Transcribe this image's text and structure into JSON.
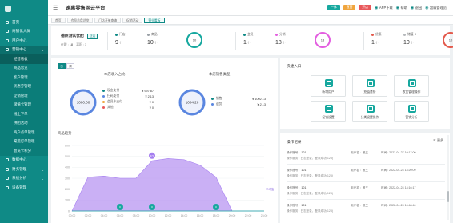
{
  "app_title": "速惠零售网云平台",
  "topbar": {
    "badges": [
      {
        "label": "一体",
        "color": "#17a89f"
      },
      {
        "label": "直营",
        "color": "#f0a53d"
      },
      {
        "label": "开店",
        "color": "#e8585a"
      }
    ],
    "links": [
      "APP下载",
      "帮助",
      "退出",
      "超级管理员"
    ]
  },
  "sidebar": {
    "items": [
      {
        "label": "首页",
        "expandable": false
      },
      {
        "label": "商铺化大屏",
        "expandable": false
      },
      {
        "label": "用户中心",
        "expandable": true
      },
      {
        "label": "营销中心",
        "expandable": true
      }
    ],
    "subitems": [
      "经营看板",
      "商品总览",
      "客户管理",
      "优惠券管理",
      "促销管理",
      "储值卡管理",
      "线上下单",
      "拼团活动",
      "商户点单管理",
      "渠道订单管理",
      "会员卡积分"
    ],
    "bottom": [
      {
        "label": "数据中心",
        "expandable": true
      },
      {
        "label": "财务管理",
        "expandable": true
      },
      {
        "label": "系统分析",
        "expandable": true
      },
      {
        "label": "设备管理",
        "expandable": true
      }
    ]
  },
  "tabs": [
    "首页",
    "会员总盘总览",
    "门店开单查询",
    "促销活动",
    "营业看板"
  ],
  "shop": {
    "name": "德州测试优配",
    "tag": "正店",
    "meta_label_1": "在职 :",
    "meta_value_1": "18",
    "meta_label_2": "离职 :",
    "meta_value_2": "1"
  },
  "stats": [
    {
      "group": [
        {
          "label": "门店",
          "value": "9",
          "unit": "个",
          "color": "#0f8a86"
        },
        {
          "label": "商品",
          "value": "10",
          "unit": "个",
          "color": "#9aa0a6"
        }
      ],
      "ring": {
        "value": "10",
        "color": "#17a89f"
      }
    },
    {
      "group": [
        {
          "label": "会员",
          "value": "1",
          "unit": "个",
          "color": "#0f8a86"
        },
        {
          "label": "分销",
          "value": "18",
          "unit": "个",
          "color": "#e35ee0"
        }
      ],
      "ring": {
        "value": "18",
        "color": "#e35ee0"
      }
    },
    {
      "group": [
        {
          "label": "优惠",
          "value": "1",
          "unit": "个",
          "color": "#e35a4c"
        },
        {
          "label": "储值卡",
          "value": "10",
          "unit": "个",
          "color": "#b5b8bb"
        }
      ],
      "ring": {
        "value": "10",
        "color": "#e35a4c"
      }
    }
  ],
  "panel": {
    "toggle": [
      "日",
      "周"
    ],
    "income_title": "本店收入占比",
    "income_center": "1000.00",
    "income_legend": [
      {
        "label": "现金支付",
        "value": "¥ 997.87",
        "color": "#0f8a86"
      },
      {
        "label": "扫码支付",
        "value": "¥ 2.13",
        "color": "#5a86e0"
      },
      {
        "label": "会员卡支付",
        "value": "¥ 0",
        "color": "#f0a53d"
      },
      {
        "label": "其他",
        "value": "¥ 0",
        "color": "#e8585a"
      }
    ],
    "sales_title": "本店销售类型",
    "sales_center": "1004.26",
    "sales_legend": [
      {
        "label": "销售",
        "value": "¥ 1002.13",
        "color": "#0f8a86"
      },
      {
        "label": "退货",
        "value": "¥ 2.13",
        "color": "#5a86e0"
      }
    ],
    "trend_title": "商品趋势"
  },
  "chart_data": {
    "type": "area",
    "x": [
      "00:00",
      "02:00",
      "04:00",
      "06:00",
      "08:00",
      "10:00",
      "12:00",
      "14:00",
      "16:00",
      "18:00",
      "20:00",
      "22:00",
      "23:00"
    ],
    "y_ticks": [
      "0",
      "100",
      "200",
      "300",
      "400",
      "500",
      "600"
    ],
    "series": [
      {
        "values": [
          0,
          310,
          320,
          300,
          300,
          460,
          480,
          470,
          420,
          310,
          0,
          0,
          0
        ],
        "color": "#b895f2"
      },
      {
        "values": [
          0,
          0,
          0,
          0,
          0,
          0,
          0,
          0,
          0,
          0,
          0,
          0,
          0
        ],
        "color": "#17a89f"
      }
    ],
    "average_label": "平均值",
    "markers": [
      {
        "x": "10:00",
        "label": "470"
      },
      {
        "x": "06:00",
        "label": "0"
      },
      {
        "x": "10:00",
        "label": "0"
      },
      {
        "x": "18:00",
        "label": "0"
      }
    ],
    "ylim": [
      0,
      600
    ]
  },
  "quick": {
    "title": "快捷入口",
    "tiles": [
      "新增用户",
      "充值套餐",
      "收货管理操作",
      "促销设置",
      "分类设置操作",
      "营销分析"
    ]
  },
  "ops": {
    "title": "操作记录",
    "more": "更多",
    "records": [
      {
        "acct_label": "操作账号 :",
        "account": "101",
        "user_label": "用户名 :",
        "user": "张三",
        "time": "时间 : 2022-04-27 10:17:00",
        "detail": "操作服务 : 日志登录，登录成功(123)"
      },
      {
        "acct_label": "操作账号 :",
        "account": "101",
        "user_label": "用户名 :",
        "user": "张三",
        "time": "时间 : 2022-04-24 14:20:09",
        "detail": "操作服务 : 日志登录，登录成功(123)"
      },
      {
        "acct_label": "操作账号 :",
        "account": "101",
        "user_label": "用户名 :",
        "user": "张三",
        "time": "时间 : 2022-04-24 14:16:17",
        "detail": "操作服务 : 日志登录，登录成功(123)"
      },
      {
        "acct_label": "操作账号 :",
        "account": "101",
        "user_label": "用户名 :",
        "user": "张三",
        "time": "时间 : 2022-04-24 10:48:40",
        "detail": "操作服务 : 日志登录，登录成功(123)"
      }
    ]
  }
}
